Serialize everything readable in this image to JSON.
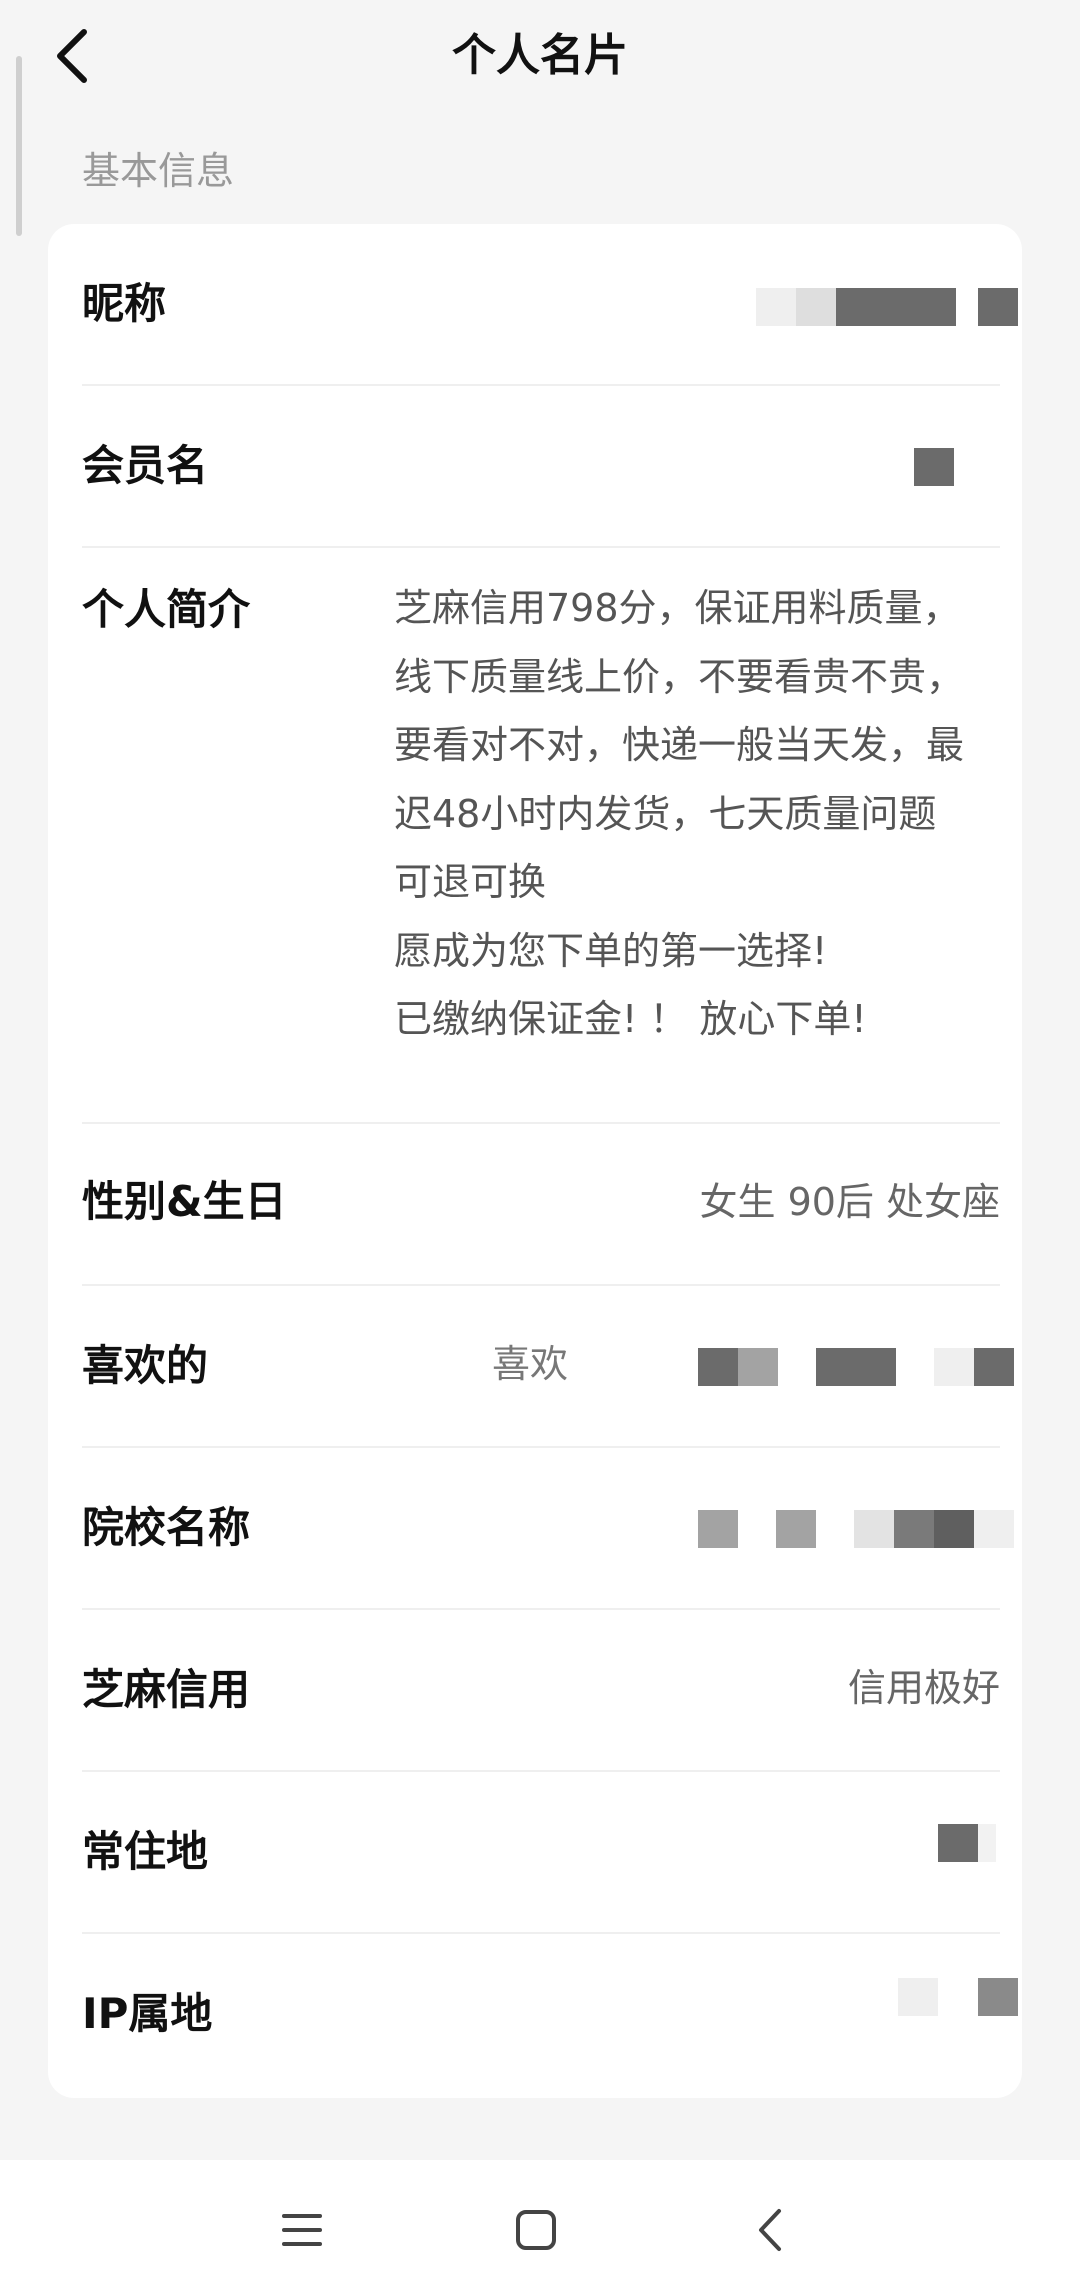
{
  "header": {
    "title": "个人名片",
    "back_icon": "chevron-left-icon"
  },
  "section": {
    "basic_info": "基本信息"
  },
  "fields": {
    "nickname": {
      "label": "昵称",
      "value_state": "pixelated"
    },
    "member_name": {
      "label": "会员名",
      "value_state": "pixelated"
    },
    "bio": {
      "label": "个人简介",
      "lines": [
        "芝麻信用798分，保证用料质量，",
        "线下质量线上价，不要看贵不贵，",
        "要看对不对，快递一般当天发，最",
        "迟48小时内发货，七天质量问题",
        "可退可换",
        "愿成为您下单的第一选择!",
        "已缴纳保证金! ！ 放心下单!"
      ]
    },
    "gender_birthday": {
      "label": "性别&生日",
      "value": "女生 90后 处女座"
    },
    "likes": {
      "label": "喜欢的",
      "value_prefix": "喜欢",
      "value_state": "pixelated"
    },
    "school": {
      "label": "院校名称",
      "value_state": "pixelated"
    },
    "sesame_credit": {
      "label": "芝麻信用",
      "value": "信用极好"
    },
    "residence": {
      "label": "常住地",
      "value_state": "pixelated"
    },
    "ip_location": {
      "label": "IP属地",
      "value_state": "pixelated"
    }
  },
  "navbar": {
    "menu_icon": "menu-icon",
    "home_icon": "home-icon",
    "back_icon": "back-icon"
  },
  "colors": {
    "page_bg": "#f5f5f5",
    "card_bg": "#ffffff",
    "label": "#111111",
    "value": "#666666",
    "section_label": "#999999",
    "pixel_dark": "#6b6b6b",
    "pixel_mid": "#a3a3a3",
    "pixel_light": "#e3e3e3"
  }
}
